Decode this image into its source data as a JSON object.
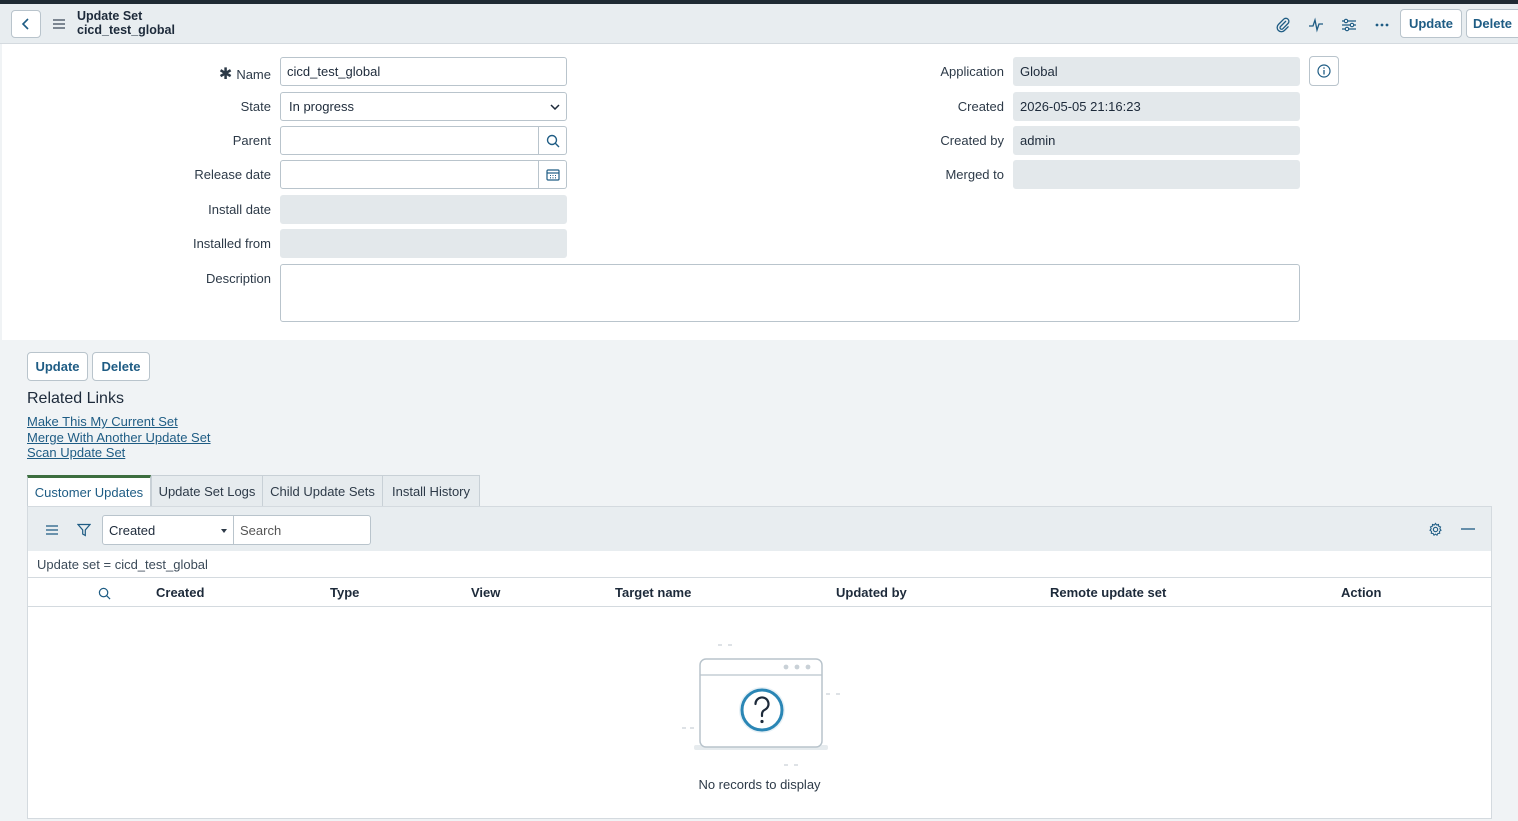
{
  "header": {
    "title": "Update Set",
    "subtitle": "cicd_test_global",
    "update_label": "Update",
    "delete_label": "Delete"
  },
  "form": {
    "name": {
      "label": "Name",
      "value": "cicd_test_global",
      "required": true
    },
    "state": {
      "label": "State",
      "value": "In progress"
    },
    "parent": {
      "label": "Parent",
      "value": ""
    },
    "release_date": {
      "label": "Release date",
      "value": ""
    },
    "install_date": {
      "label": "Install date",
      "value": ""
    },
    "installed_from": {
      "label": "Installed from",
      "value": ""
    },
    "description": {
      "label": "Description",
      "value": ""
    },
    "application": {
      "label": "Application",
      "value": "Global"
    },
    "created": {
      "label": "Created",
      "value": "2026-05-05 21:16:23"
    },
    "created_by": {
      "label": "Created by",
      "value": "admin"
    },
    "merged_to": {
      "label": "Merged to",
      "value": ""
    }
  },
  "actions": {
    "update_label": "Update",
    "delete_label": "Delete"
  },
  "related_links": {
    "title": "Related Links",
    "links": [
      "Make This My Current Set",
      "Merge With Another Update Set",
      "Scan Update Set"
    ]
  },
  "tabs": [
    "Customer Updates",
    "Update Set Logs",
    "Child Update Sets",
    "Install History"
  ],
  "list": {
    "filter_field": "Created",
    "search_placeholder": "Search",
    "breadcrumb": "Update set = cicd_test_global",
    "columns": [
      "Created",
      "Type",
      "View",
      "Target name",
      "Updated by",
      "Remote update set",
      "Action"
    ],
    "empty_message": "No records to display"
  },
  "colors": {
    "accent": "#1e5c84",
    "active_tab": "#3c6e3f"
  }
}
